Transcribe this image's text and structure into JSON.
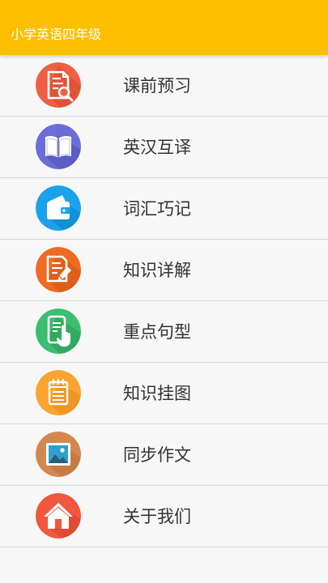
{
  "app": {
    "title": "小学英语四年级"
  },
  "colors": {
    "appbar": "#fdbf00",
    "background": "#f7f7f7",
    "divider": "#d9d9d9",
    "text": "#333333"
  },
  "menu": {
    "items": [
      {
        "label": "课前预习",
        "icon": "document-search-icon",
        "color": "#ee5f44"
      },
      {
        "label": "英汉互译",
        "icon": "open-book-icon",
        "color": "#6b6ed6"
      },
      {
        "label": "词汇巧记",
        "icon": "wallet-icon",
        "color": "#1aa3ea"
      },
      {
        "label": "知识详解",
        "icon": "document-edit-icon",
        "color": "#ef6b23"
      },
      {
        "label": "重点句型",
        "icon": "phone-touch-icon",
        "color": "#3dbd6f"
      },
      {
        "label": "知识挂图",
        "icon": "notepad-icon",
        "color": "#fba530"
      },
      {
        "label": "同步作文",
        "icon": "picture-icon",
        "color": "#d4884f"
      },
      {
        "label": "关于我们",
        "icon": "home-icon",
        "color": "#f0573e"
      }
    ]
  }
}
